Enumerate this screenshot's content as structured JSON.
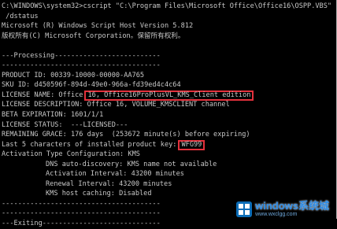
{
  "console": {
    "lines": [
      "C:\\WINDOWS\\system32>cscript \"C:\\Program Files\\Microsoft Office\\Office16\\OSPP.VBS\"",
      " /dstatus",
      "Microsoft (R) Windows Script Host Version 5.812",
      "版权所有(C) Microsoft Corporation。保留所有权利。",
      "",
      "---Processing--------------------------",
      "---------------------------------------",
      "PRODUCT ID: 00339-10000-00000-AA765",
      "SKU ID: d450596f-894d-49e0-966a-fd39ed4c4c64"
    ],
    "license_name_prefix": "LICENSE NAME: Office",
    "license_name_value": "16, Office16ProPlusVL_KMS_Client edition",
    "lines_mid": [
      "LICENSE DESCRIPTION: Office 16, VOLUME_KMSCLIENT channel",
      "BETA EXPIRATION: 1601/1/1",
      "LICENSE STATUS:  ---LICENSED---",
      "REMAINING GRACE: 176 days  (253672 minute(s) before expiring)"
    ],
    "last5_prefix": "Last 5 characters of installed product key:",
    "last5_value": "WFG99",
    "activation_type": "Activation Type Configuration: KMS",
    "kms_lines": [
      "DNS auto-discovery: KMS name not available",
      "Activation Interval: 43200 minutes",
      "Renewal Interval: 43200 minutes",
      "KMS host caching: Disabled"
    ],
    "lines_end": [
      "---------------------------------------",
      "---------------------------------------",
      "---Exiting-----------------------------"
    ]
  },
  "watermark": {
    "brand": "windows系统城",
    "url": "www.wxclgg.com"
  },
  "colors": {
    "background": "#000000",
    "text": "#c8c8c8",
    "highlight_border": "#e3313c",
    "watermark_blue": "#2d8ce6"
  },
  "icons": {
    "watermark_logo": "windows-logo-icon"
  }
}
